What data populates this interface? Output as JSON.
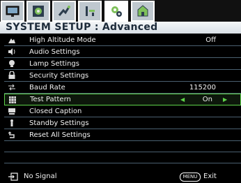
{
  "tabs": [
    {
      "icon": "display-icon"
    },
    {
      "icon": "picture-icon"
    },
    {
      "icon": "source-icon"
    },
    {
      "icon": "system-basic-icon"
    },
    {
      "icon": "system-advanced-icon",
      "active": true
    },
    {
      "icon": "information-icon"
    }
  ],
  "title": "SYSTEM SETUP : Advanced",
  "items": [
    {
      "icon": "altitude-icon",
      "label": "High Altitude Mode",
      "value": "Off"
    },
    {
      "icon": "audio-icon",
      "label": "Audio Settings",
      "value": ""
    },
    {
      "icon": "lamp-icon",
      "label": "Lamp Settings",
      "value": ""
    },
    {
      "icon": "lock-icon",
      "label": "Security Settings",
      "value": ""
    },
    {
      "icon": "baud-rate-icon",
      "label": "Baud Rate",
      "value": "115200"
    },
    {
      "icon": "test-pattern-icon",
      "label": "Test Pattern",
      "value": "On",
      "selected": true
    },
    {
      "icon": "closed-caption-icon",
      "label": "Closed Caption",
      "value": ""
    },
    {
      "icon": "standby-icon",
      "label": "Standby Settings",
      "value": ""
    },
    {
      "icon": "reset-icon",
      "label": "Reset All Settings",
      "value": ""
    }
  ],
  "footer": {
    "status": "No Signal",
    "menu_button": "MENU",
    "exit_label": "Exit"
  },
  "colors": {
    "highlight_border": "#5ed34a",
    "background": "#000000",
    "divider": "#4a6070"
  }
}
